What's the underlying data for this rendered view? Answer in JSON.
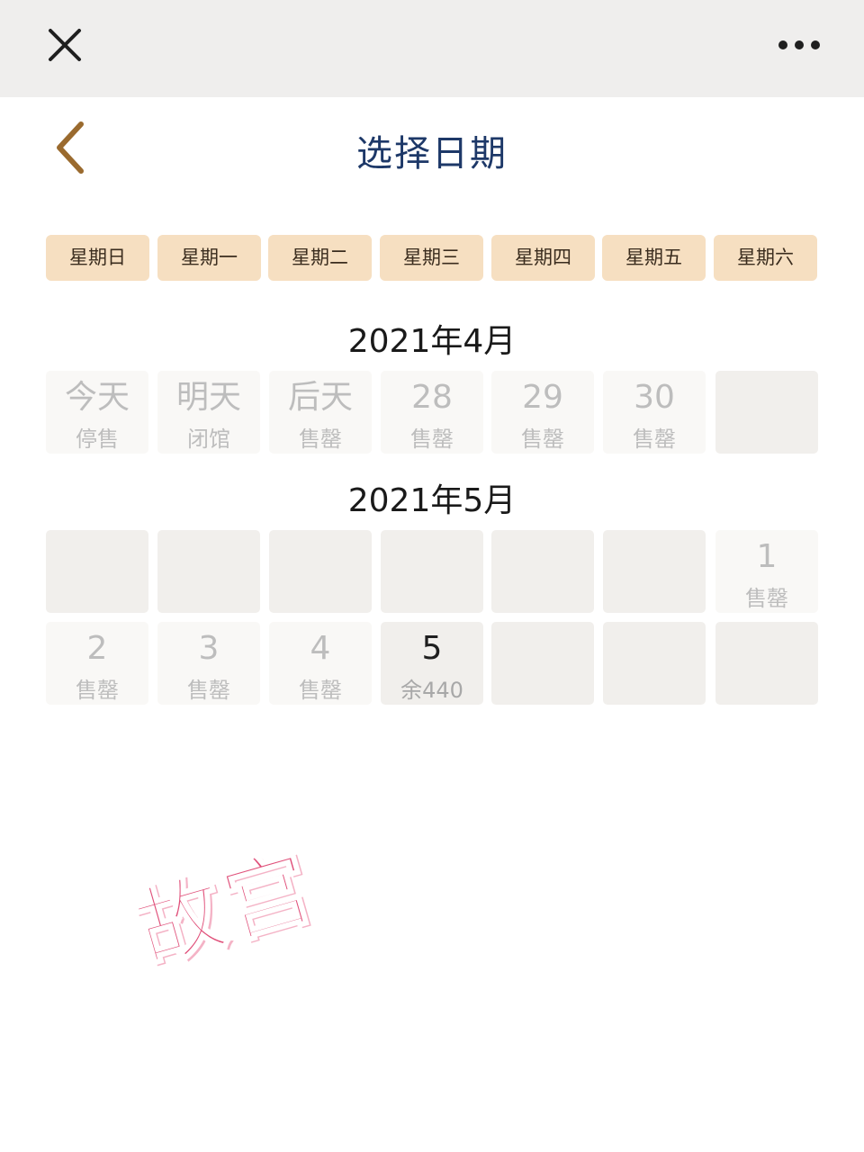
{
  "header": {
    "title": "选择日期"
  },
  "weekdays": [
    "星期日",
    "星期一",
    "星期二",
    "星期三",
    "星期四",
    "星期五",
    "星期六"
  ],
  "calendar": {
    "april": {
      "title": "2021年4月",
      "days": [
        {
          "num": "今天",
          "status": "停售"
        },
        {
          "num": "明天",
          "status": "闭馆"
        },
        {
          "num": "后天",
          "status": "售罄"
        },
        {
          "num": "28",
          "status": "售罄"
        },
        {
          "num": "29",
          "status": "售罄"
        },
        {
          "num": "30",
          "status": "售罄"
        }
      ]
    },
    "may": {
      "title": "2021年5月",
      "days": [
        {
          "num": "1",
          "status": "售罄"
        },
        {
          "num": "2",
          "status": "售罄"
        },
        {
          "num": "3",
          "status": "售罄"
        },
        {
          "num": "4",
          "status": "售罄"
        },
        {
          "num": "5",
          "status": "余440"
        }
      ]
    }
  },
  "watermark": "故宫",
  "colors": {
    "title": "#1d3868",
    "weekday_bg": "#f6dfc1",
    "back_arrow": "#9a6a2e",
    "stamp": "#e0507a"
  },
  "icons": {
    "close": "close-icon",
    "more": "more-icon",
    "back": "back-arrow-icon"
  }
}
